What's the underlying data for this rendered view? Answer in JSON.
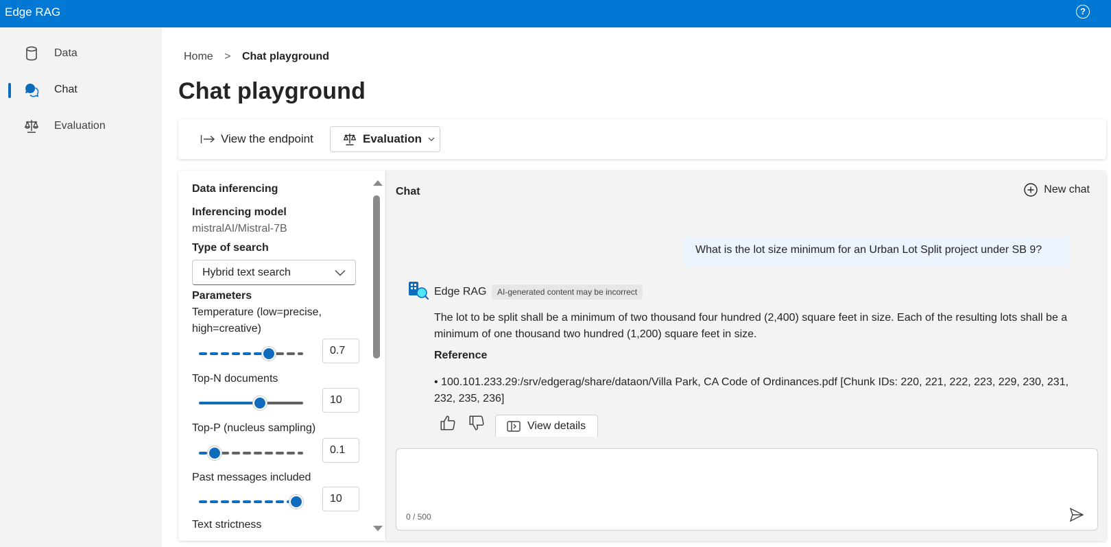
{
  "app": {
    "title": "Edge RAG",
    "help_icon": "question-circle-icon",
    "help_glyph": "?"
  },
  "colors": {
    "brand": "#0078d4",
    "accent": "#0f6cbd",
    "sidebar_bg": "#f3f3f3",
    "chat_bg": "#f3f3f3",
    "user_bubble": "#ebf3fc"
  },
  "sidebar": {
    "items": [
      {
        "label": "Data",
        "icon": "database-icon",
        "active": false
      },
      {
        "label": "Chat",
        "icon": "chat-bubbles-icon",
        "active": true
      },
      {
        "label": "Evaluation",
        "icon": "scales-icon",
        "active": false
      }
    ]
  },
  "breadcrumb": {
    "home": "Home",
    "separator": ">",
    "current": "Chat playground"
  },
  "page": {
    "title": "Chat playground"
  },
  "toolbar": {
    "view_endpoint": "View the endpoint",
    "evaluation": "Evaluation"
  },
  "settings": {
    "section_title": "Data inferencing",
    "model_label": "Inferencing model",
    "model_value": "mistralAI/Mistral-7B",
    "search_type_label": "Type of search",
    "search_type_value": "Hybrid text search",
    "parameters_label": "Parameters",
    "sliders": [
      {
        "label": "Temperature (low=precise, high=creative)",
        "value": "0.7",
        "level": 0.7,
        "style": "dashed"
      },
      {
        "label": "Top-N documents",
        "value": "10",
        "level": 0.6,
        "style": "solid"
      },
      {
        "label": "Top-P (nucleus sampling)",
        "value": "0.1",
        "level": 0.1,
        "style": "dashed"
      },
      {
        "label": "Past messages included",
        "value": "10",
        "level": 1.0,
        "style": "dashed"
      }
    ],
    "next_label": "Text strictness"
  },
  "chat": {
    "title": "Chat",
    "new_chat": "New chat",
    "user_message": "What is the lot size minimum for an Urban Lot Split project under SB 9?",
    "bot_name": "Edge RAG",
    "ai_badge": "AI-generated content may be incorrect",
    "bot_answer": "The lot to be split shall be a minimum of two thousand four hundred (2,400) square feet in size. Each of the resulting lots shall be a minimum of one thousand two hundred (1,200) square feet in size.",
    "reference_title": "Reference",
    "reference_item": "• 100.101.233.29:/srv/edgerag/share/dataon/Villa Park, CA Code of Ordinances.pdf [Chunk IDs: 220, 221, 222, 223, 229, 230, 231, 232, 235, 236]",
    "view_details": "View details",
    "char_count": "0 / 500"
  }
}
